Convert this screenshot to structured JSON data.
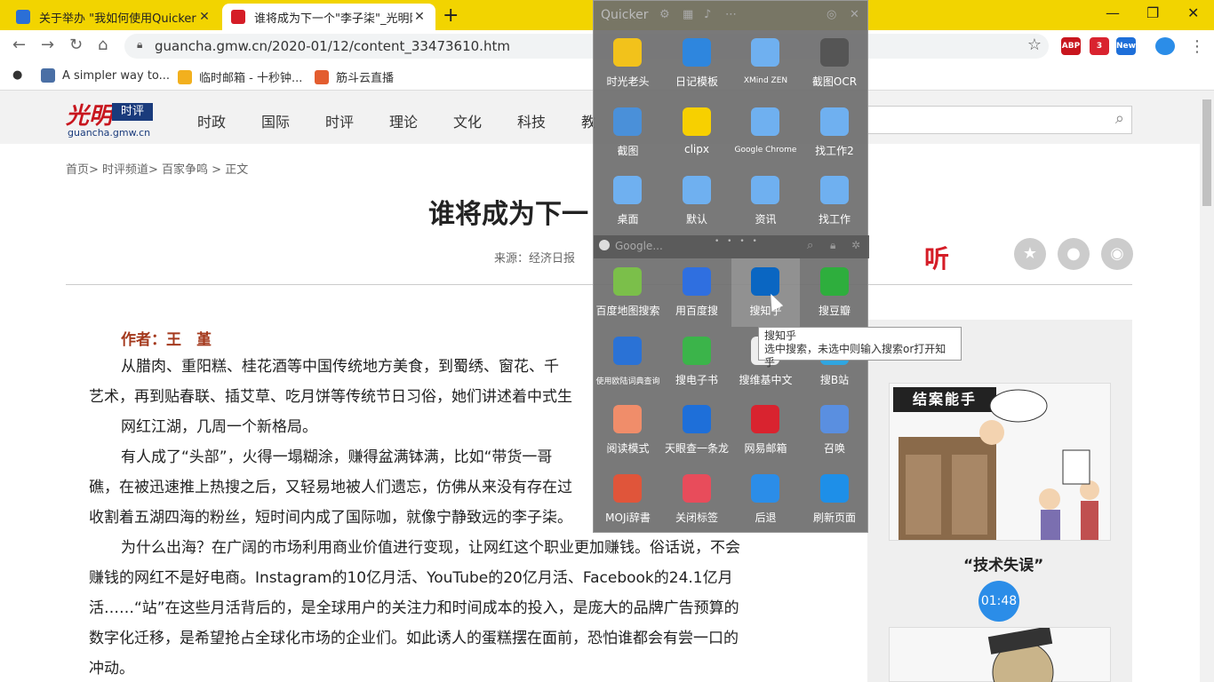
{
  "browser": {
    "tabs": [
      {
        "title": "关于举办 \"我如何使用Quicker\"主",
        "icon": "quicker-favicon"
      },
      {
        "title": "谁将成为下一个\"李子柒\"_光明网",
        "icon": "gmw-favicon"
      }
    ],
    "new_tab": "+",
    "url": "guancha.gmw.cn/2020-01/12/content_33473610.htm",
    "bookmarks": [
      "A simpler way to...",
      "临时邮箱 - 十秒钟...",
      "筋斗云直播"
    ],
    "extensions": [
      "ABP 1",
      "3",
      "New"
    ]
  },
  "site": {
    "logo_cn": "光明",
    "logo_badge": "时评",
    "logo_domain": "guancha.gmw.cn",
    "nav": [
      "时政",
      "国际",
      "时评",
      "理论",
      "文化",
      "科技",
      "教"
    ]
  },
  "article": {
    "breadcrumb": "首页> 时评频道> 百家争鸣 > 正文",
    "title": "谁将成为下一",
    "source": "来源：经济日报",
    "listen": "听",
    "author": "作者：王　堇",
    "paragraphs": [
      "从腊肉、重阳糕、桂花酒等中国传统地方美食，到蜀绣、窗花、千",
      "艺术，再到贴春联、插艾草、吃月饼等传统节日习俗，她们讲述着中式生",
      "网红江湖，几周一个新格局。",
      "有人成了“头部”，火得一塌糊涂，赚得盆满钵满，比如“带货一哥",
      "礁，在被迅速推上热搜之后，又轻易地被人们遗忘，仿佛从来没有存在过",
      "收割着五湖四海的粉丝，短时间内成了国际咖，就像宁静致远的李子柒。",
      "为什么出海？在广阔的市场利用商业价值进行变现，让网红这个职业更加赚钱。俗话说，不会",
      "赚钱的网红不是好电商。Instagram的10亿月活、YouTube的20亿月活、Facebook的24.1亿月",
      "活……“站”在这些月活背后的，是全球用户的关注力和时间成本的投入，是庞大的品牌广告预算的",
      "数字化迁移，是希望抢占全球化市场的企业们。如此诱人的蛋糕摆在面前，恐怕谁都会有尝一口的",
      "冲动。"
    ]
  },
  "sidebar": {
    "cartoon1_banner": "结案能手",
    "caption": "“技术失误”",
    "badge": "01:48"
  },
  "quicker": {
    "title": "Quicker",
    "group_title": "Google...",
    "top_actions": [
      {
        "label": "时光老头",
        "color": "#f2c21b",
        "icon": "clock-icon"
      },
      {
        "label": "日记模板",
        "color": "#2e86de",
        "icon": "note-icon"
      },
      {
        "label": "XMind ZEN",
        "color": "#6fb0f0",
        "icon": "window-icon"
      },
      {
        "label": "截图OCR",
        "color": "#555555",
        "icon": "scan-icon"
      },
      {
        "label": "截图",
        "color": "#4a90d9",
        "icon": "image-icon"
      },
      {
        "label": "clipx",
        "color": "#f7d000",
        "icon": "clip-icon"
      },
      {
        "label": "Google Chrome",
        "color": "#6fb0f0",
        "icon": "window-icon"
      },
      {
        "label": "找工作2",
        "color": "#6fb0f0",
        "icon": "window-icon"
      },
      {
        "label": "桌面",
        "color": "#6fb0f0",
        "icon": "window-icon"
      },
      {
        "label": "默认",
        "color": "#6fb0f0",
        "icon": "window-icon"
      },
      {
        "label": "资讯",
        "color": "#6fb0f0",
        "icon": "window-icon"
      },
      {
        "label": "找工作",
        "color": "#6fb0f0",
        "icon": "window-icon"
      }
    ],
    "bottom_actions": [
      {
        "label": "百度地图搜索",
        "color": "#7bbf4a",
        "icon": "map-icon"
      },
      {
        "label": "用百度搜",
        "color": "#2f6fe0",
        "icon": "baidu-icon"
      },
      {
        "label": "搜知乎",
        "color": "#0a66c2",
        "icon": "zhihu-icon"
      },
      {
        "label": "搜豆瓣",
        "color": "#2eae3d",
        "icon": "douban-icon"
      },
      {
        "label": "使用欧陆词典查询",
        "color": "#2a72d6",
        "icon": "dict-icon"
      },
      {
        "label": "搜电子书",
        "color": "#3bb44a",
        "icon": "book-icon"
      },
      {
        "label": "搜维基中文",
        "color": "#eeeeee",
        "icon": "wiki-icon"
      },
      {
        "label": "搜B站",
        "color": "#2fa5e0",
        "icon": "bilibili-icon"
      },
      {
        "label": "阅读模式",
        "color": "#f08d6a",
        "icon": "reader-icon"
      },
      {
        "label": "天眼查一条龙",
        "color": "#1e6fd9",
        "icon": "tianyan-icon"
      },
      {
        "label": "网易邮箱",
        "color": "#d9232f",
        "icon": "mail-icon"
      },
      {
        "label": "召唤",
        "color": "#5a8fe0",
        "icon": "link-icon"
      },
      {
        "label": "MOJi辞書",
        "color": "#e0553a",
        "icon": "moji-icon"
      },
      {
        "label": "关闭标签",
        "color": "#e84c5b",
        "icon": "close-tab-icon"
      },
      {
        "label": "后退",
        "color": "#2b8de8",
        "icon": "back-icon"
      },
      {
        "label": "刷新页面",
        "color": "#1e8fe8",
        "icon": "refresh-icon"
      }
    ],
    "tooltip_title": "搜知乎",
    "tooltip_desc": "选中搜索，未选中则输入搜索or打开知乎"
  }
}
